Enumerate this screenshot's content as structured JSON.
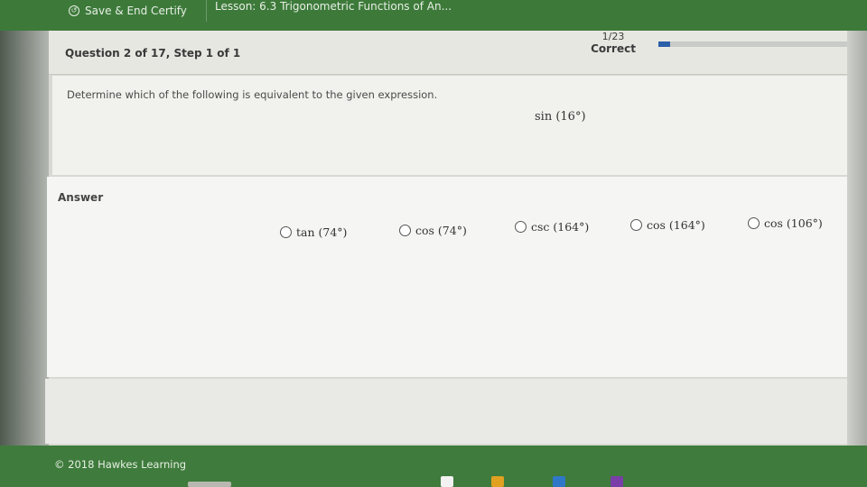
{
  "topbar": {
    "save_label": "Save & End Certify",
    "save_icon": "circle-arrow-icon",
    "lesson_title": "Lesson: 6.3 Trigonometric Functions of An..."
  },
  "header": {
    "question_title": "Question 2 of 17, Step 1 of 1",
    "score_count": "1/23",
    "score_status": "Correct",
    "progress_fraction": 0.06
  },
  "question": {
    "prompt": "Determine which of the following is equivalent to the given expression.",
    "expression": "sin (16°)"
  },
  "answer": {
    "label": "Answer",
    "choices": [
      {
        "label": "tan (74°)"
      },
      {
        "label": "cos (74°)"
      },
      {
        "label": "csc (164°)"
      },
      {
        "label": "cos (164°)"
      },
      {
        "label": "cos (106°)"
      }
    ]
  },
  "footer": {
    "copyright": "© 2018 Hawkes Learning"
  },
  "colors": {
    "brand_green": "#3d7a3a",
    "progress_blue": "#2b5fa8"
  }
}
